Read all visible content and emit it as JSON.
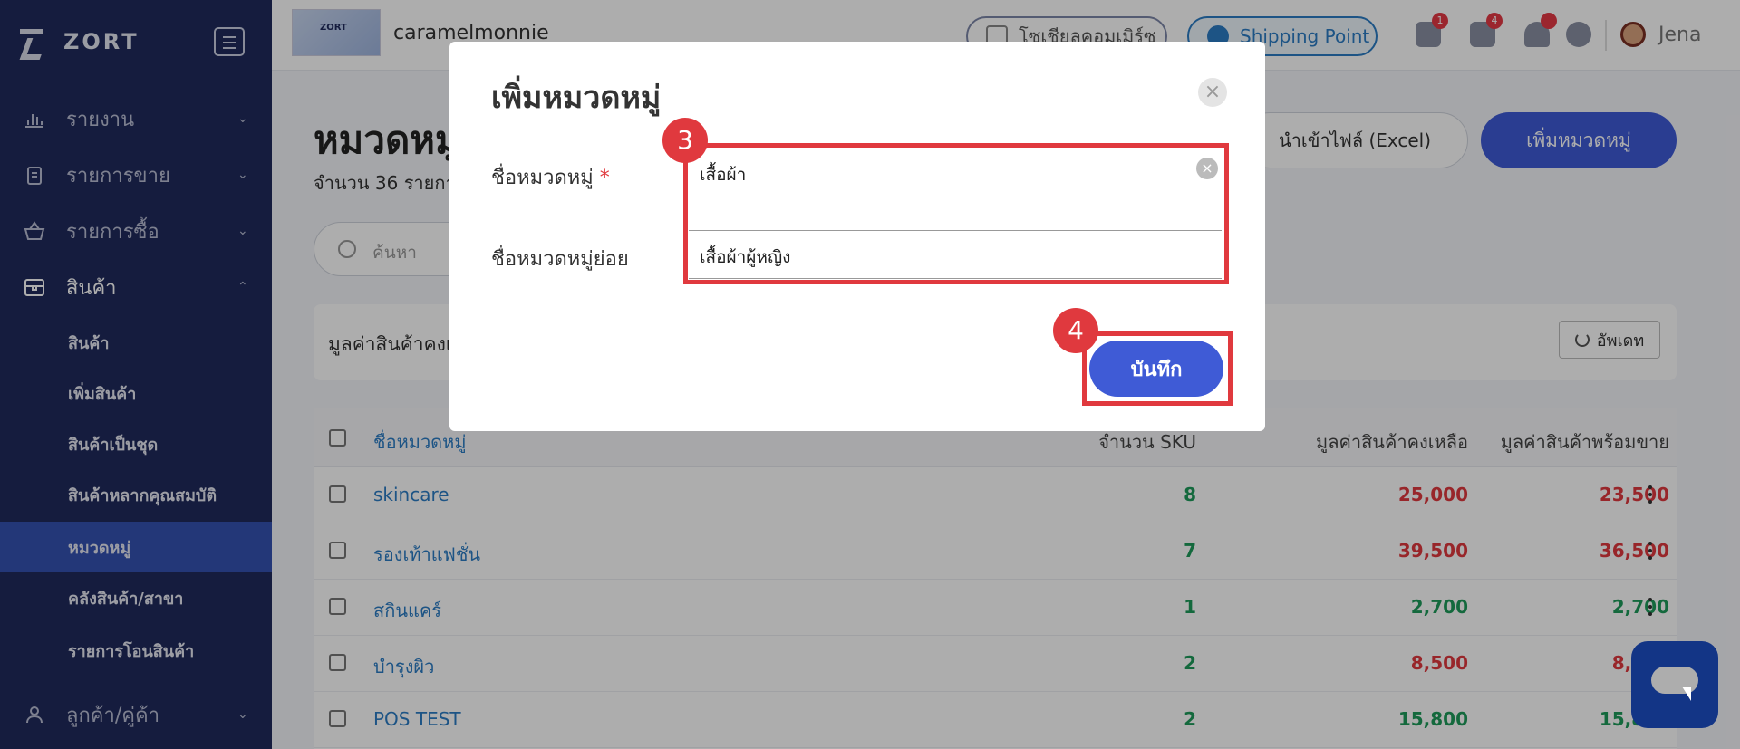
{
  "sidebar": {
    "brand": "ZORT",
    "nav": [
      {
        "label": "รายงาน",
        "icon": "bar-chart-icon"
      },
      {
        "label": "รายการขาย",
        "icon": "clipboard-icon"
      },
      {
        "label": "รายการซื้อ",
        "icon": "basket-icon"
      },
      {
        "label": "สินค้า",
        "icon": "box-icon"
      },
      {
        "label": "ลูกค้า/คู่ค้า",
        "icon": "users-icon"
      }
    ],
    "sub_items": [
      {
        "label": "สินค้า"
      },
      {
        "label": "เพิ่มสินค้า"
      },
      {
        "label": "สินค้าเป็นชุด"
      },
      {
        "label": "สินค้าหลากคุณสมบัติ"
      },
      {
        "label": "หมวดหมู่"
      },
      {
        "label": "คลังสินค้า/สาขา"
      },
      {
        "label": "รายการโอนสินค้า"
      }
    ]
  },
  "topbar": {
    "shop_name": "caramelmonnie",
    "social_label": "โซเชียลคอมเมิร์ซ",
    "shipping_label": "Shipping Point",
    "badges": [
      "1",
      "4"
    ],
    "user_name": "Jena"
  },
  "page": {
    "title": "หมวดหมู่",
    "subtitle": "จำนวน 36 รายการ",
    "import_label": "นำเข้าไฟล์ (Excel)",
    "add_label": "เพิ่มหมวดหมู่",
    "search_placeholder": "ค้นหา",
    "value_label": "มูลค่าสินค้าคงเหลือ",
    "refresh_label": "อัพเดท"
  },
  "table": {
    "headers": [
      "ชื่อหมวดหมู่",
      "จำนวน SKU",
      "มูลค่าสินค้าคงเหลือ",
      "มูลค่าสินค้าพร้อมขาย"
    ],
    "rows": [
      {
        "name": "skincare",
        "sku": "8",
        "stock_value": "25,000",
        "ready_value": "23,500"
      },
      {
        "name": "รองเท้าแฟชั่น",
        "sku": "7",
        "stock_value": "39,500",
        "ready_value": "36,500"
      },
      {
        "name": "สกินแคร์",
        "sku": "1",
        "stock_value": "2,700",
        "ready_value": "2,700"
      },
      {
        "name": "บำรุงผิว",
        "sku": "2",
        "stock_value": "8,500",
        "ready_value": "8,100"
      },
      {
        "name": "POS TEST",
        "sku": "2",
        "stock_value": "15,800",
        "ready_value": "15,800"
      }
    ]
  },
  "modal": {
    "title": "เพิ่มหมวดหมู่",
    "category_label": "ชื่อหมวดหมู่",
    "required_mark": "*",
    "category_value": "เสื้อผ้า",
    "subcategory_label": "ชื่อหมวดหมู่ย่อย",
    "subcategory_value": "เสื้อผ้าผู้หญิง",
    "save_label": "บันทึก",
    "step_a": "3",
    "step_b": "4"
  },
  "colors": {
    "sidebar": "#1f2a5c",
    "accent": "#3f5bd6",
    "highlight": "#e0393e",
    "positive": "#1e9b5b"
  }
}
